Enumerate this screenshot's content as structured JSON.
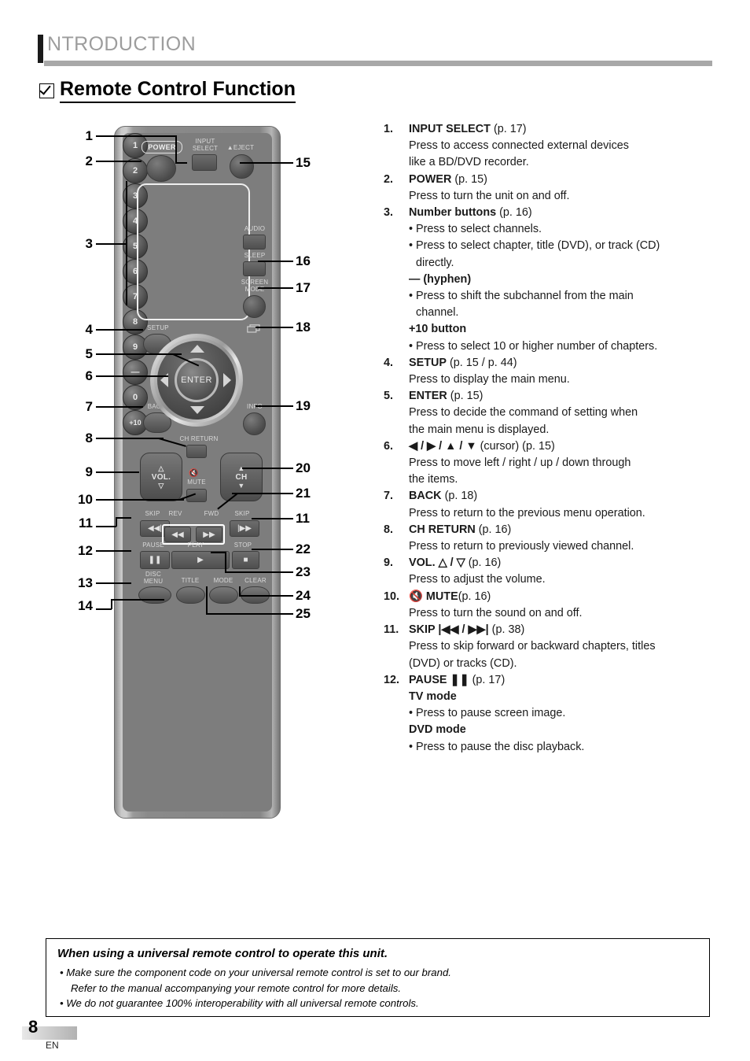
{
  "header": {
    "title": "NTRODUCTION",
    "section_heading": "Remote Control Function",
    "checkbox_icon": "checked-box-icon"
  },
  "remote": {
    "labels": {
      "power": "POWER",
      "input_select": "INPUT\nSELECT",
      "eject": "▲EJECT",
      "audio": "AUDIO",
      "sleep": "SLEEP",
      "screen_mode": "SCREEN\nMODE",
      "setup": "SETUP",
      "enter": "ENTER",
      "back": "BACK",
      "info": "INFO",
      "ch_return": "CH RETURN",
      "vol": "VOL.",
      "mute": "MUTE",
      "ch": "CH",
      "skip_left": "SKIP",
      "skip_right": "SKIP",
      "rev": "REV",
      "fwd": "FWD",
      "pause": "PAUSE",
      "play": "PLAY",
      "stop": "STOP",
      "disc_menu": "DISC\nMENU",
      "title": "TITLE",
      "mode": "MODE",
      "clear": "CLEAR"
    },
    "keypad": [
      "1",
      "2",
      "3",
      "4",
      "5",
      "6",
      "7",
      "8",
      "9",
      "—",
      "0",
      "+10"
    ],
    "callouts_left": [
      "1",
      "2",
      "3",
      "4",
      "5",
      "6",
      "7",
      "8",
      "9",
      "10",
      "11",
      "12",
      "13",
      "14"
    ],
    "callouts_right": [
      "15",
      "16",
      "17",
      "18",
      "19",
      "20",
      "21",
      "11",
      "22",
      "23",
      "24",
      "25"
    ]
  },
  "descriptions": [
    {
      "num": "1.",
      "title": "INPUT SELECT",
      "page": " (p. 17)",
      "lines": [
        {
          "text": "Press to access connected external devices",
          "style": "plain"
        },
        {
          "text": "like a BD/DVD recorder.",
          "style": "plain"
        }
      ]
    },
    {
      "num": "2.",
      "title": "POWER",
      "page": " (p. 15)",
      "lines": [
        {
          "text": "Press to turn the unit on and off.",
          "style": "plain"
        }
      ]
    },
    {
      "num": "3.",
      "title": "Number buttons",
      "page": " (p. 16)",
      "lines": [
        {
          "text": "• Press to select channels.",
          "style": "bullet"
        },
        {
          "text": "• Press to select chapter, title (DVD), or track (CD)",
          "style": "bullet"
        },
        {
          "text": "directly.",
          "style": "indent"
        },
        {
          "text": "— (hyphen)",
          "style": "bold"
        },
        {
          "text": "• Press to shift the subchannel from the main",
          "style": "bullet"
        },
        {
          "text": "channel.",
          "style": "indent"
        },
        {
          "text": "+10 button",
          "style": "bold"
        },
        {
          "text": "• Press to select 10 or higher number of chapters.",
          "style": "bullet"
        }
      ]
    },
    {
      "num": "4.",
      "title": "SETUP",
      "page": " (p. 15 / p. 44)",
      "lines": [
        {
          "text": "Press to display the main menu.",
          "style": "plain"
        }
      ]
    },
    {
      "num": "5.",
      "title": "ENTER",
      "page": " (p. 15)",
      "lines": [
        {
          "text": "Press to decide the command of setting when",
          "style": "plain"
        },
        {
          "text": "the main menu is displayed.",
          "style": "plain"
        }
      ]
    },
    {
      "num": "6.",
      "title": "◀ / ▶ / ▲ / ▼",
      "page": " (cursor) (p. 15)",
      "lines": [
        {
          "text": "Press to move left / right / up / down through",
          "style": "plain"
        },
        {
          "text": "the items.",
          "style": "plain"
        }
      ]
    },
    {
      "num": "7.",
      "title": "BACK",
      "page": " (p. 18)",
      "lines": [
        {
          "text": "Press to return to the previous menu operation.",
          "style": "plain"
        }
      ]
    },
    {
      "num": "8.",
      "title": "CH RETURN",
      "page": " (p. 16)",
      "lines": [
        {
          "text": "Press to return to previously viewed channel.",
          "style": "plain"
        }
      ]
    },
    {
      "num": "9.",
      "title": "VOL. △ / ▽",
      "page": " (p. 16)",
      "lines": [
        {
          "text": "Press to adjust the volume.",
          "style": "plain"
        }
      ]
    },
    {
      "num": "10.",
      "title": "🔇 MUTE",
      "page": "(p. 16)",
      "lines": [
        {
          "text": "Press to turn the sound on and off.",
          "style": "plain"
        }
      ]
    },
    {
      "num": "11.",
      "title": "SKIP |◀◀ / ▶▶|",
      "page": " (p. 38)",
      "lines": [
        {
          "text": "Press to skip forward or backward chapters, titles",
          "style": "plain"
        },
        {
          "text": "(DVD) or tracks (CD).",
          "style": "plain"
        }
      ]
    },
    {
      "num": "12.",
      "title": "PAUSE ❚❚",
      "page": " (p. 17)",
      "lines": [
        {
          "text": "TV mode",
          "style": "bold"
        },
        {
          "text": "• Press to pause screen image.",
          "style": "bullet"
        },
        {
          "text": "DVD mode",
          "style": "bold"
        },
        {
          "text": "• Press to pause the disc playback.",
          "style": "bullet"
        }
      ]
    }
  ],
  "note": {
    "title": "When using a universal remote control to operate this unit.",
    "lines": [
      "• Make sure the component code on your universal remote control is set to our brand.",
      "Refer to the manual accompanying your remote control for more details.",
      "• We do not guarantee 100% interoperability with all universal remote controls."
    ]
  },
  "footer": {
    "page_number": "8",
    "lang": "EN"
  }
}
